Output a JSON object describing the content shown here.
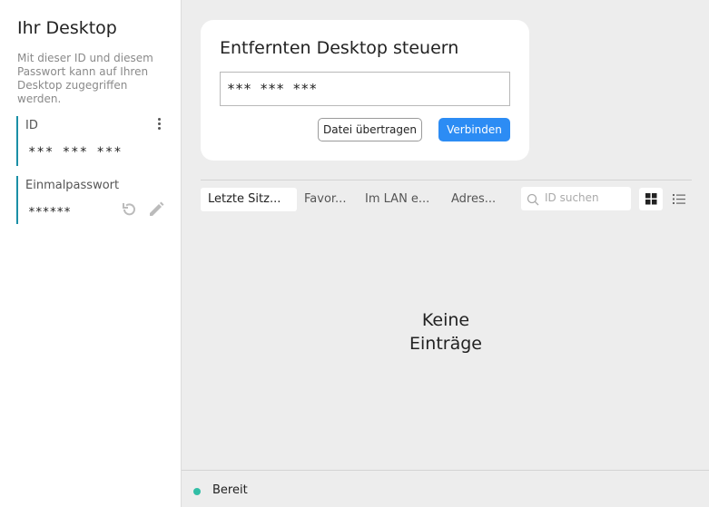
{
  "sidebar": {
    "title": "Ihr Desktop",
    "description": "Mit dieser ID und diesem Passwort kann auf Ihren Desktop zugegriffen werden.",
    "id_field": {
      "label": "ID",
      "value": "*** *** ***"
    },
    "password_field": {
      "label": "Einmalpasswort",
      "value": "******"
    }
  },
  "remote_card": {
    "title": "Entfernten Desktop steuern",
    "id_value": "*** *** ***",
    "transfer_button": "Datei übertragen",
    "connect_button": "Verbinden"
  },
  "tabs": [
    "Letzte Sitz...",
    "Favor...",
    "Im LAN e...",
    "Adres..."
  ],
  "search": {
    "placeholder": "ID suchen"
  },
  "empty_state": "Keine Einträge",
  "status": {
    "text": "Bereit"
  },
  "colors": {
    "accent": "#2c8cf4",
    "status_ok": "#32bea6",
    "field_border": "#1a8fa6"
  },
  "icons": [
    "kebab-menu-icon",
    "refresh-icon",
    "edit-icon",
    "search-icon",
    "grid-view-icon",
    "list-view-icon"
  ]
}
